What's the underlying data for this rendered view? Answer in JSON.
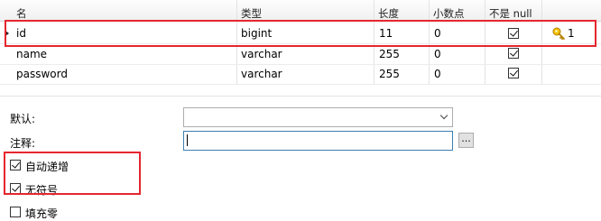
{
  "table": {
    "columns": [
      "名",
      "类型",
      "长度",
      "小数点",
      "不是 null",
      ""
    ],
    "rows": [
      {
        "name": "id",
        "type": "bigint",
        "length": "11",
        "decimals": "0",
        "not_null": true,
        "key": "1"
      },
      {
        "name": "name",
        "type": "varchar",
        "length": "255",
        "decimals": "0",
        "not_null": true,
        "key": ""
      },
      {
        "name": "password",
        "type": "varchar",
        "length": "255",
        "decimals": "0",
        "not_null": true,
        "key": ""
      }
    ]
  },
  "props": {
    "default_label": "默认:",
    "default_value": "",
    "comment_label": "注释:",
    "comment_value": "",
    "browse_button": "..."
  },
  "options": [
    {
      "label": "自动递增",
      "checked": true
    },
    {
      "label": "无符号",
      "checked": true
    },
    {
      "label": "填充零",
      "checked": false
    }
  ],
  "colors": {
    "highlight": "#e5262f",
    "key_icon": "#e0a800"
  }
}
